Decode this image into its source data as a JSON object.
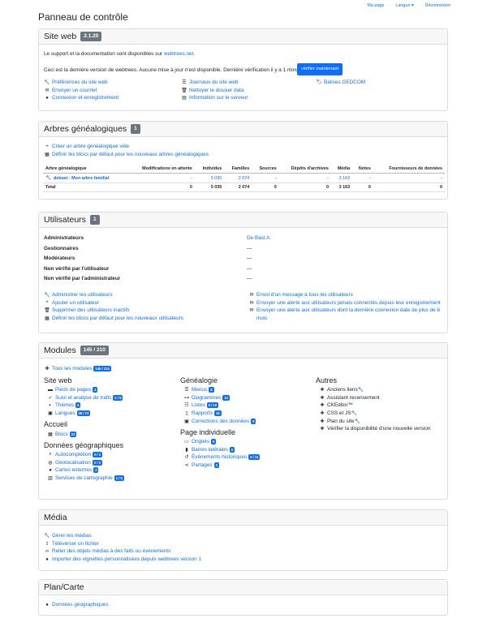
{
  "nav": [
    "Ma page",
    "Langue ▾",
    "Déconnexion"
  ],
  "title": "Panneau de contrôle",
  "site": {
    "title": "Site web",
    "version": "2.1.20",
    "support_text": "Le support et la documentation sont disponibles sur",
    "support_link": "webtrees.net",
    "support_dot": ".",
    "latest_text": "Ceci est la dernière version de webtrees. Aucune mise à jour n'est disponible. Dernière vérification il y a 1 minute.",
    "check_button": "vérifier maintenant",
    "links_col1": [
      "Préférences du site web",
      "Envoyer un courriel",
      "Connexion et enregistrement"
    ],
    "links_col2": [
      "Journaux du site web",
      "Nettoyer le dossier data",
      "Information sur le serveur"
    ],
    "links_col3": [
      "Balises GEDCOM"
    ]
  },
  "trees": {
    "title": "Arbres généalogiques",
    "count": "1",
    "actions": [
      "Créer un arbre généalogique vide",
      "Définir les blocs par défaut pour les nouveaux arbres généalogiques"
    ],
    "headers": [
      "Arbre généalogique",
      "Modifications en attente",
      "Individus",
      "Familles",
      "Sources",
      "Dépôts d'archives",
      "Média",
      "Notes",
      "Fournisseurs de données"
    ],
    "row": [
      "debast - Mon arbre familial",
      "-",
      "5 035",
      "2 074",
      "-",
      "-",
      "3 163",
      "-",
      "-"
    ],
    "total": [
      "Total",
      "0",
      "5 035",
      "2 074",
      "0",
      "0",
      "3 163",
      "0",
      "0"
    ]
  },
  "users": {
    "title": "Utilisateurs",
    "count": "1",
    "stats": [
      {
        "label": "Administrateurs",
        "value": "De Bast A"
      },
      {
        "label": "Gestionnaires",
        "value": "—"
      },
      {
        "label": "Modérateurs",
        "value": "—"
      },
      {
        "label": "Non vérifié par l'utilisateur",
        "value": "—"
      },
      {
        "label": "Non vérifié par l'administrateur",
        "value": "—"
      }
    ],
    "links_left": [
      "Administrer les utilisateurs",
      "Ajouter un utilisateur",
      "Supprimer des utilisateurs inactifs",
      "Définir les blocs par défaut pour les nouveaux utilisateurs"
    ],
    "links_right": [
      "Envoi d'un message à tous les utilisateurs",
      "Envoyer une alerte aux utilisateurs jamais connectés depuis leur enregistrement",
      "Envoyer une alerte aux utilisateurs dont la dernière connexion date de plus de 6",
      "mois"
    ]
  },
  "modules": {
    "title": "Modules",
    "count": "145 / 210",
    "all_label": "Tous les modules",
    "all_badge": "145 / 210",
    "site_h": "Site web",
    "site": [
      [
        "Pieds de pages",
        "4"
      ],
      [
        "Suivi et analyse de trafic",
        "0 / 5"
      ],
      [
        "Thèmes",
        "6"
      ],
      [
        "Langues",
        "36 / 72"
      ]
    ],
    "accueil_h": "Accueil",
    "accueil": [
      [
        "Blocs",
        "23"
      ]
    ],
    "geo_h": "Données géographiques",
    "geo": [
      [
        "Autocomplétion",
        "0 / 2"
      ],
      [
        "Géolocalisation",
        "0 / 3"
      ],
      [
        "Cartes externes",
        "3"
      ],
      [
        "Services de cartographie",
        "1 / 6"
      ]
    ],
    "gen_h": "Généalogie",
    "gen": [
      [
        "Menus",
        "9"
      ],
      [
        "Diagrammes",
        "13"
      ],
      [
        "Listes",
        "9 / 10"
      ],
      [
        "Rapports",
        "16"
      ],
      [
        "Corrections des données",
        "9"
      ]
    ],
    "ind_h": "Page individuelle",
    "ind": [
      [
        "Onglets",
        "9"
      ],
      [
        "Barres latérales",
        "5"
      ],
      [
        "Événements historiques",
        "0 / 11"
      ],
      [
        "Partages",
        "2"
      ]
    ],
    "autres_h": "Autres",
    "autres": [
      "Anciens liens",
      "Assistant recensement",
      "CKEditor™",
      "CSS et JS",
      "Plan du site",
      "Vérifier la disponibilité d'une nouvelle version"
    ]
  },
  "media": {
    "title": "Média",
    "links": [
      "Gérer les médias",
      "Téléverser un fichier",
      "Relier des objets médias à des faits ou événements",
      "Importer des vignettes personnalisées depuis webtrees version 1"
    ]
  },
  "map": {
    "title": "Plan/Carte",
    "links": [
      "Données géographiques"
    ]
  }
}
